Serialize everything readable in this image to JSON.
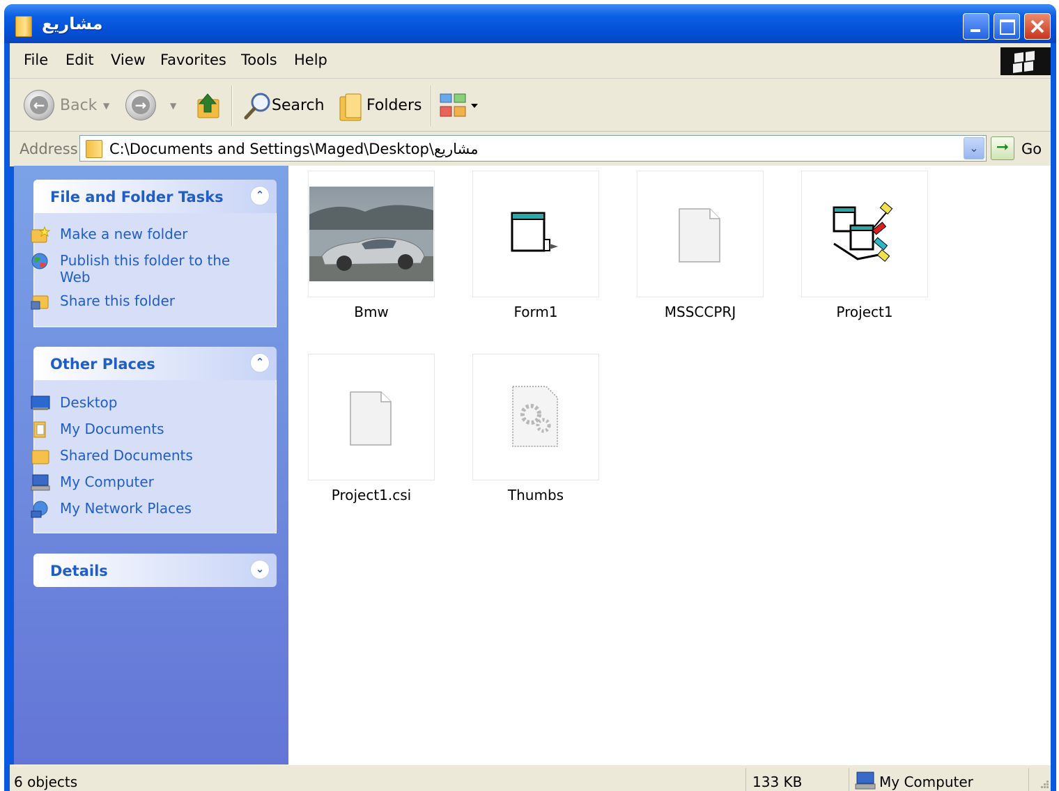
{
  "window": {
    "title": "مشاريع"
  },
  "menu": [
    "File",
    "Edit",
    "View",
    "Favorites",
    "Tools",
    "Help"
  ],
  "toolbar": {
    "back_label": "Back",
    "search_label": "Search",
    "folders_label": "Folders"
  },
  "address": {
    "label": "Address",
    "path": "C:\\Documents and Settings\\Maged\\Desktop\\مشاريع",
    "go_label": "Go"
  },
  "panels": {
    "file_tasks": {
      "title": "File and Folder Tasks",
      "items": [
        "Make a new folder",
        "Publish this folder to the Web",
        "Share this folder"
      ]
    },
    "other_places": {
      "title": "Other Places",
      "items": [
        "Desktop",
        "My Documents",
        "Shared Documents",
        "My Computer",
        "My Network Places"
      ]
    },
    "details": {
      "title": "Details"
    }
  },
  "files": [
    {
      "name": "Bmw",
      "icon": "photo-thumbnail"
    },
    {
      "name": "Form1",
      "icon": "vb-form-icon"
    },
    {
      "name": "MSSCCPRJ",
      "icon": "blank-file-icon"
    },
    {
      "name": "Project1",
      "icon": "vb-project-icon"
    },
    {
      "name": "Project1.csi",
      "icon": "blank-file-icon"
    },
    {
      "name": "Thumbs",
      "icon": "system-file-icon"
    }
  ],
  "status": {
    "objects": "6 objects",
    "size": "133 KB",
    "location": "My Computer"
  }
}
